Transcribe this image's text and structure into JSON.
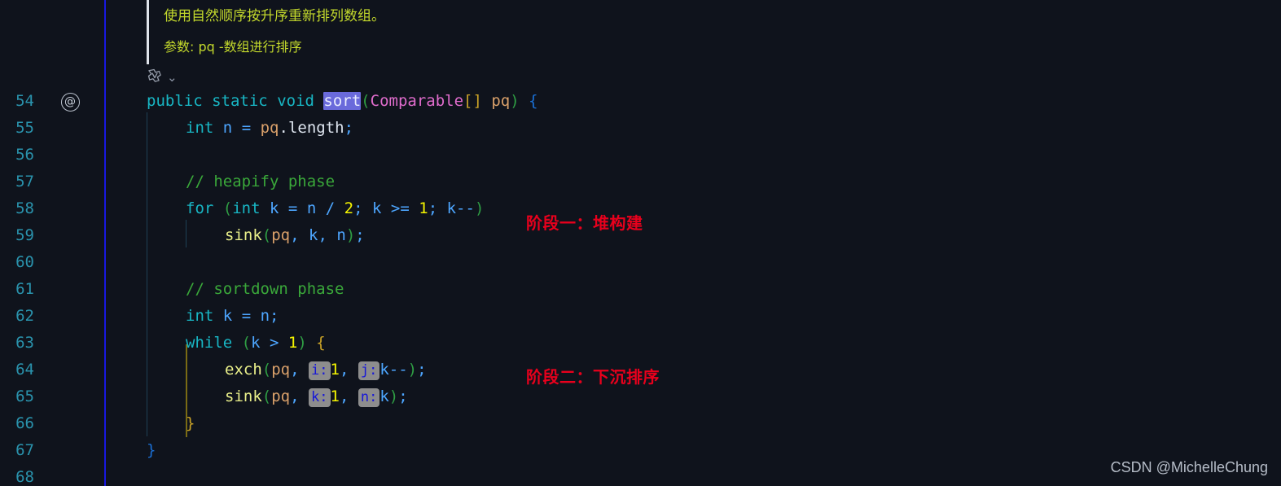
{
  "editor": {
    "background": "#0f131c",
    "gutter_border_color": "#1818e0",
    "line_number_color": "#2a93ad"
  },
  "doc_comment": {
    "line1": "使用自然顺序按升序重新排列数组。",
    "line2": "参数: pq -数组进行排序",
    "color": "#c3d82c"
  },
  "code_lens": {
    "icon": "vue-file-icon",
    "chevron": "⌄"
  },
  "gutter": {
    "annotation_icon_line": "54",
    "annotation_icon": "@",
    "line_numbers": [
      "54",
      "55",
      "56",
      "57",
      "58",
      "59",
      "60",
      "61",
      "62",
      "63",
      "64",
      "65",
      "66",
      "67",
      "68"
    ]
  },
  "code": {
    "l54": {
      "kw1": "public",
      "kw2": "static",
      "kw3": "void",
      "name": "sort",
      "paren_open": "(",
      "type": "Comparable",
      "brackets": "[]",
      "param": "pq",
      "paren_close": ")",
      "brace": "{"
    },
    "l55": {
      "kw": "int",
      "var": "n",
      "eq": "=",
      "param": "pq",
      "dot": ".",
      "field": "length",
      "semi": ";"
    },
    "l57": {
      "comment": "// heapify phase"
    },
    "l58": {
      "kw": "for",
      "p1": "(",
      "kw2": "int",
      "v1": "k",
      "eq1": "=",
      "v2": "n",
      "slash": "/",
      "num1": "2",
      "s1": ";",
      "v3": "k",
      "gte": ">=",
      "num2": "1",
      "s2": ";",
      "v4": "k--",
      "p2": ")"
    },
    "l59": {
      "fn": "sink",
      "p1": "(",
      "param": "pq",
      "c1": ",",
      "v1": "k",
      "c2": ",",
      "v2": "n",
      "p2": ")",
      "semi": ";"
    },
    "l61": {
      "comment": "// sortdown phase"
    },
    "l62": {
      "kw": "int",
      "var": "k",
      "eq": "=",
      "v2": "n",
      "semi": ";"
    },
    "l63": {
      "kw": "while",
      "p1": "(",
      "v1": "k",
      "gt": ">",
      "num": "1",
      "p2": ")",
      "brace": "{"
    },
    "l64": {
      "fn": "exch",
      "p1": "(",
      "param": "pq",
      "c1": ",",
      "hint1": "i:",
      "num1": "1",
      "c2": ",",
      "hint2": "j:",
      "v1": "k--",
      "p2": ")",
      "semi": ";"
    },
    "l65": {
      "fn": "sink",
      "p1": "(",
      "param": "pq",
      "c1": ",",
      "hint1": "k:",
      "num1": "1",
      "c2": ",",
      "hint2": "n:",
      "v1": "k",
      "p2": ")",
      "semi": ";"
    },
    "l66": {
      "brace": "}"
    },
    "l67": {
      "brace": "}"
    }
  },
  "annotations": [
    {
      "text": "阶段一：堆构建",
      "color": "#e8001c"
    },
    {
      "text": "阶段二：下沉排序",
      "color": "#e8001c"
    }
  ],
  "watermark": "CSDN @MichelleChung"
}
